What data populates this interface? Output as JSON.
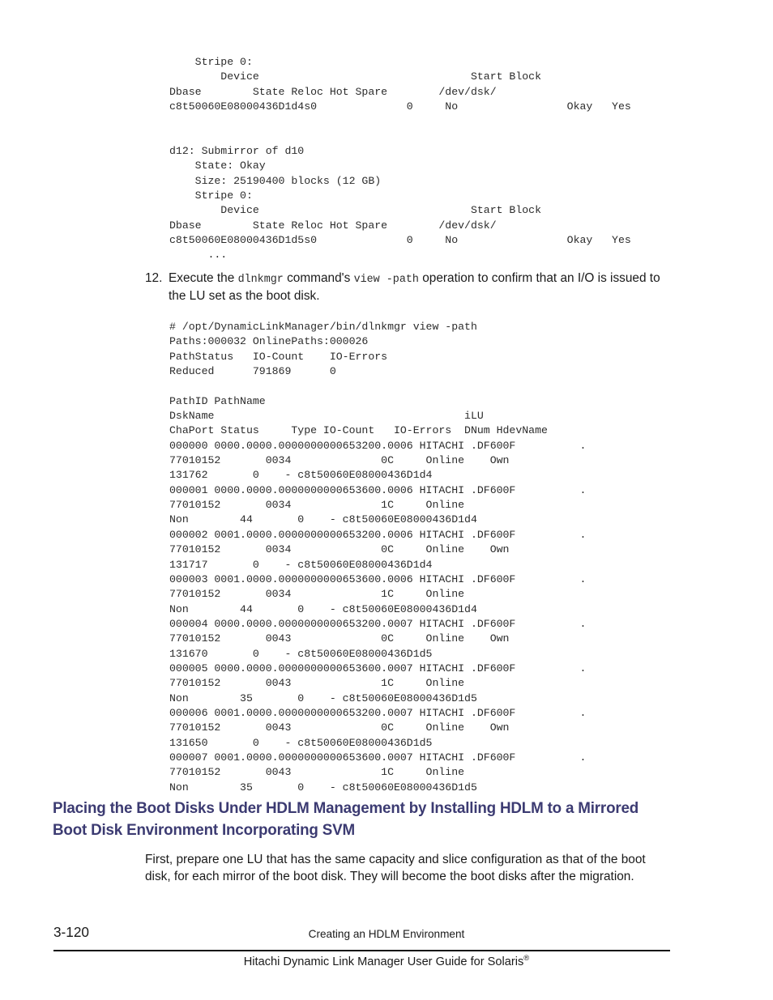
{
  "document": {
    "page_number": "3-120",
    "chapter_footer": "Creating an HDLM Environment",
    "guide_title": "Hitachi Dynamic Link Manager User Guide for Solaris",
    "guide_title_superscript": "®"
  },
  "code_svm_status": {
    "lines": "    Stripe 0:\n        Device                                 Start Block\nDbase        State Reloc Hot Spare        /dev/dsk/\nc8t50060E08000436D1d4s0              0     No                 Okay   Yes\n\n\nd12: Submirror of d10\n    State: Okay\n    Size: 25190400 blocks (12 GB)\n    Stripe 0:\n        Device                                 Start Block\nDbase        State Reloc Hot Spare        /dev/dsk/\nc8t50060E08000436D1d5s0              0     No                 Okay   Yes\n      ..."
  },
  "step12": {
    "number": "12.",
    "text_part1": "Execute the ",
    "command1": "dlnkmgr",
    "text_part2": " command's ",
    "command2": "view -path",
    "text_part3": " operation to confirm that an I/O is issued to the LU set as the boot disk."
  },
  "code_view_path": {
    "lines": "# /opt/DynamicLinkManager/bin/dlnkmgr view -path\nPaths:000032 OnlinePaths:000026\nPathStatus   IO-Count    IO-Errors\nReduced      791869      0\n\nPathID PathName\nDskName                                       iLU\nChaPort Status     Type IO-Count   IO-Errors  DNum HdevName\n000000 0000.0000.0000000000653200.0006 HITACHI .DF600F          .\n77010152       0034              0C     Online    Own\n131762       0    - c8t50060E08000436D1d4\n000001 0000.0000.0000000000653600.0006 HITACHI .DF600F          .\n77010152       0034              1C     Online\nNon        44       0    - c8t50060E08000436D1d4\n000002 0001.0000.0000000000653200.0006 HITACHI .DF600F          .\n77010152       0034              0C     Online    Own\n131717       0    - c8t50060E08000436D1d4\n000003 0001.0000.0000000000653600.0006 HITACHI .DF600F          .\n77010152       0034              1C     Online\nNon        44       0    - c8t50060E08000436D1d4\n000004 0000.0000.0000000000653200.0007 HITACHI .DF600F          .\n77010152       0043              0C     Online    Own\n131670       0    - c8t50060E08000436D1d5\n000005 0000.0000.0000000000653600.0007 HITACHI .DF600F          .\n77010152       0043              1C     Online\nNon        35       0    - c8t50060E08000436D1d5\n000006 0001.0000.0000000000653200.0007 HITACHI .DF600F          .\n77010152       0043              0C     Online    Own\n131650       0    - c8t50060E08000436D1d5\n000007 0001.0000.0000000000653600.0007 HITACHI .DF600F          .\n77010152       0043              1C     Online\nNon        35       0    - c8t50060E08000436D1d5"
  },
  "section": {
    "heading": "Placing the Boot Disks Under HDLM Management by Installing HDLM to a Mirrored Boot Disk Environment Incorporating SVM",
    "heading_color": "#3c3b72",
    "paragraph": "First, prepare one LU that has the same capacity and slice configuration as that of the boot disk, for each mirror of the boot disk. They will become the boot disks after the migration."
  }
}
